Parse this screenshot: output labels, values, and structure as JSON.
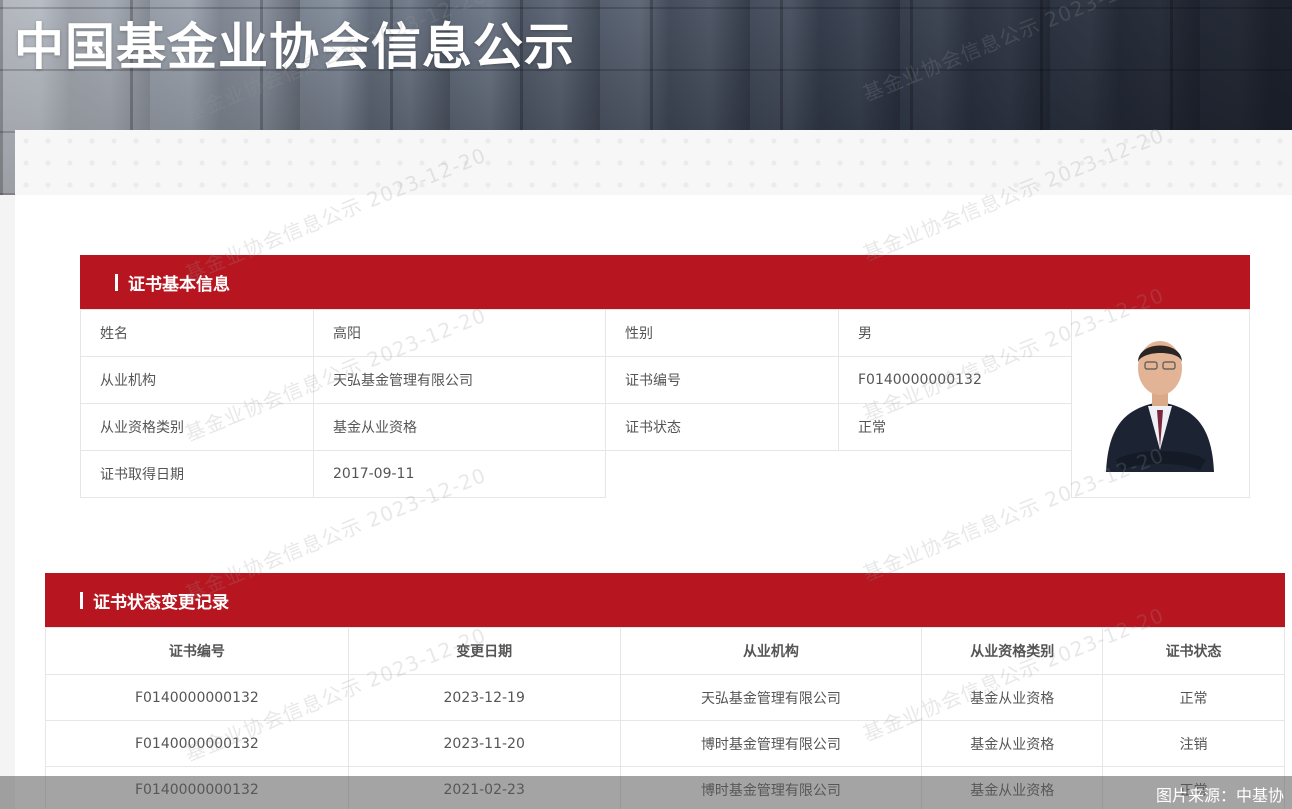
{
  "header": {
    "title": "中国基金业协会信息公示"
  },
  "watermark_text": "基金业协会信息公示 2023-12-20",
  "basic_info": {
    "section_title": "证书基本信息",
    "fields": {
      "name_label": "姓名",
      "name_value": "高阳",
      "gender_label": "性别",
      "gender_value": "男",
      "org_label": "从业机构",
      "org_value": "天弘基金管理有限公司",
      "cert_no_label": "证书编号",
      "cert_no_value": "F0140000000132",
      "qual_label": "从业资格类别",
      "qual_value": "基金从业资格",
      "status_label": "证书状态",
      "status_value": "正常",
      "date_label": "证书取得日期",
      "date_value": "2017-09-11"
    }
  },
  "records": {
    "section_title": "证书状态变更记录",
    "columns": [
      "证书编号",
      "变更日期",
      "从业机构",
      "从业资格类别",
      "证书状态"
    ],
    "rows": [
      [
        "F0140000000132",
        "2023-12-19",
        "天弘基金管理有限公司",
        "基金从业资格",
        "正常"
      ],
      [
        "F0140000000132",
        "2023-11-20",
        "博时基金管理有限公司",
        "基金从业资格",
        "注销"
      ],
      [
        "F0140000000132",
        "2021-02-23",
        "博时基金管理有限公司",
        "基金从业资格",
        "正常"
      ]
    ]
  },
  "caption": "图片来源：中基协"
}
